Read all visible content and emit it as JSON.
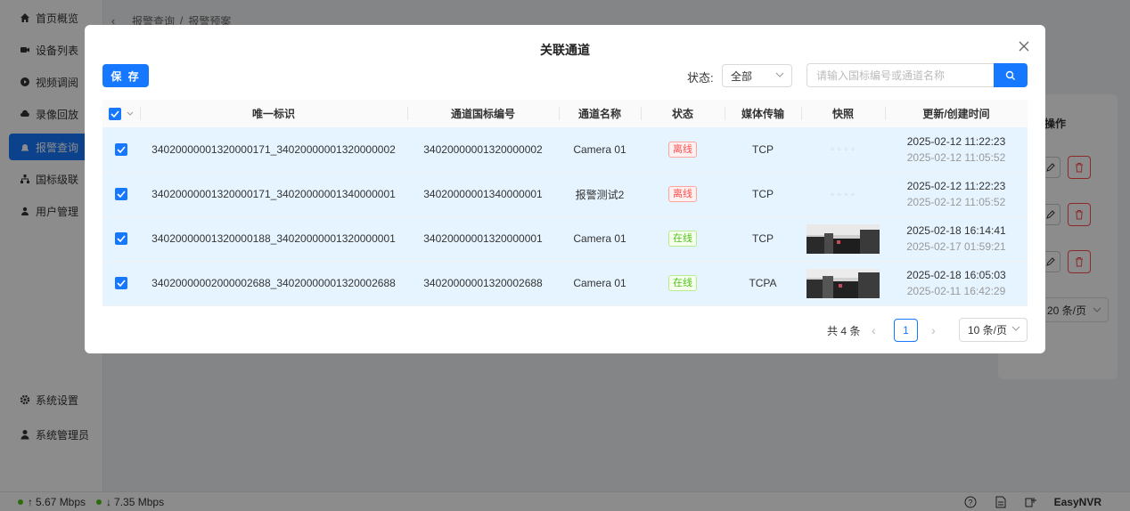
{
  "sidebar": {
    "items": [
      {
        "label": "首页概览",
        "icon": "home-icon"
      },
      {
        "label": "设备列表",
        "icon": "video-camera-icon"
      },
      {
        "label": "视频调阅",
        "icon": "play-circle-icon"
      },
      {
        "label": "录像回放",
        "icon": "cloud-icon"
      },
      {
        "label": "报警查询",
        "icon": "alarm-icon",
        "active": true
      },
      {
        "label": "国标级联",
        "icon": "cascade-icon"
      },
      {
        "label": "用户管理",
        "icon": "users-icon"
      }
    ],
    "bottom": [
      {
        "label": "系统设置",
        "icon": "gear-icon"
      },
      {
        "label": "系统管理员",
        "icon": "user-icon"
      }
    ]
  },
  "breadcrumb": {
    "parent": "报警查询",
    "sep": "/",
    "current": "报警预案"
  },
  "background": {
    "op_header": "操作",
    "page_size": "20 条/页"
  },
  "statusbar": {
    "up": "5.67 Mbps",
    "down": "7.35 Mbps",
    "brand": "EasyNVR"
  },
  "modal": {
    "title": "关联通道",
    "save_label": "保 存",
    "status_label": "状态:",
    "status_value": "全部",
    "search_placeholder": "请输入国标编号或通道名称",
    "columns": [
      "唯一标识",
      "通道国标编号",
      "通道名称",
      "状态",
      "媒体传输",
      "快照",
      "更新/创建时间"
    ],
    "rows": [
      {
        "id": "34020000001320000171_34020000001320000002",
        "gb": "34020000001320000002",
        "name": "Camera 01",
        "status": "离线",
        "online": false,
        "transport": "TCP",
        "snapshot": false,
        "updated": "2025-02-12 11:22:23",
        "created": "2025-02-12 11:05:52"
      },
      {
        "id": "34020000001320000171_34020000001340000001",
        "gb": "34020000001340000001",
        "name": "报警测试2",
        "status": "离线",
        "online": false,
        "transport": "TCP",
        "snapshot": false,
        "updated": "2025-02-12 11:22:23",
        "created": "2025-02-12 11:05:52"
      },
      {
        "id": "34020000001320000188_34020000001320000001",
        "gb": "34020000001320000001",
        "name": "Camera 01",
        "status": "在线",
        "online": true,
        "transport": "TCP",
        "snapshot": true,
        "updated": "2025-02-18 16:14:41",
        "created": "2025-02-17 01:59:21"
      },
      {
        "id": "34020000002000002688_34020000001320002688",
        "gb": "34020000001320002688",
        "name": "Camera 01",
        "status": "在线",
        "online": true,
        "transport": "TCPA",
        "snapshot": true,
        "updated": "2025-02-18 16:05:03",
        "created": "2025-02-11 16:42:29"
      }
    ],
    "pagination": {
      "total": "共 4 条",
      "page": "1",
      "page_size": "10 条/页"
    }
  },
  "colors": {
    "primary": "#1677ff",
    "row_selected": "#e6f4ff",
    "offline": "#ff4d4f",
    "online": "#52c41a"
  }
}
